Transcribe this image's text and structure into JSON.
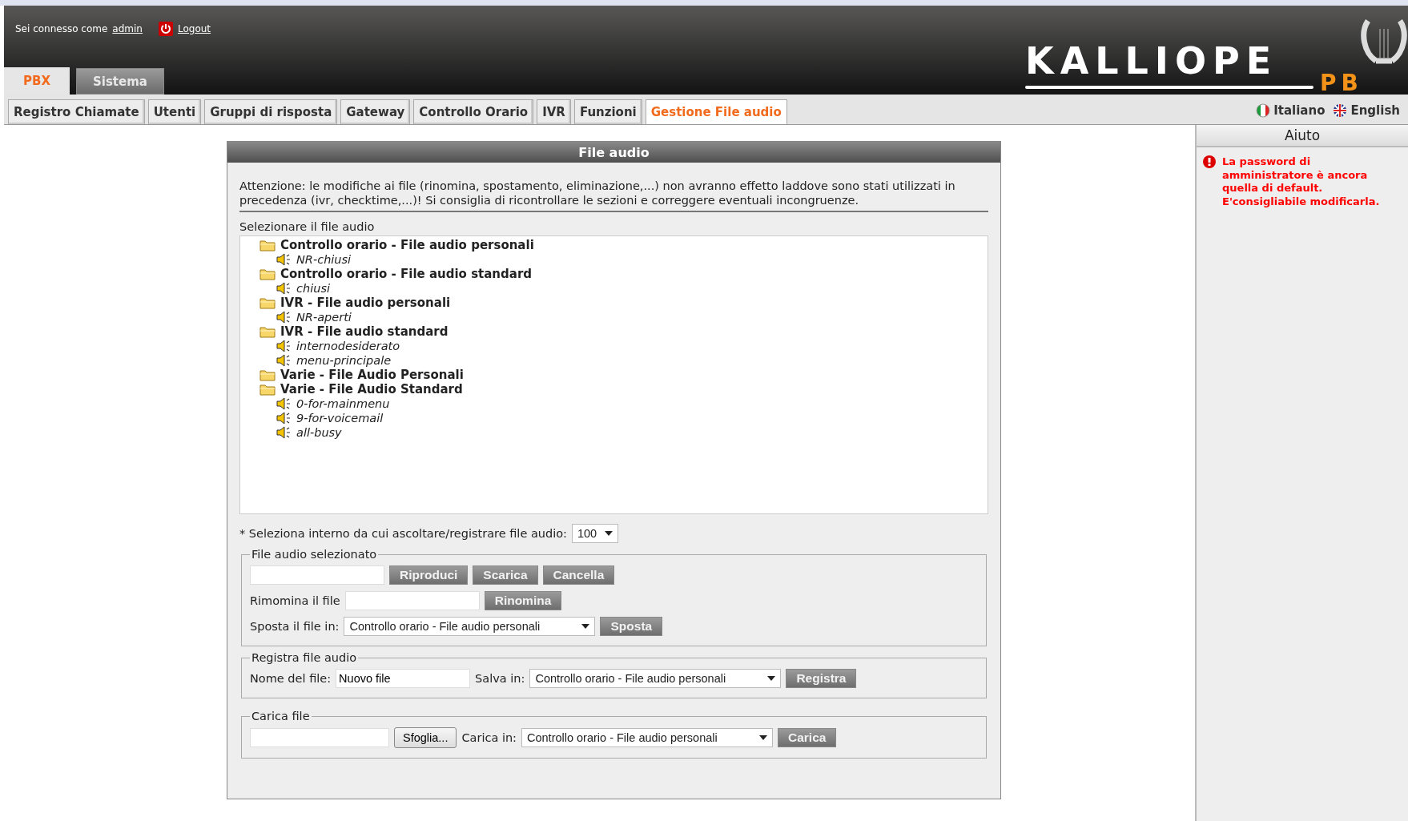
{
  "header": {
    "login_prefix": "Sei connesso come",
    "user": "admin",
    "logout": "Logout",
    "logo_title": "KALLIOPE",
    "logo_subtitle": "PB"
  },
  "main_tabs": [
    {
      "label": "PBX",
      "selected": true
    },
    {
      "label": "Sistema",
      "selected": false
    }
  ],
  "sub_tabs": [
    {
      "label": "Registro Chiamate",
      "selected": false
    },
    {
      "label": "Utenti",
      "selected": false
    },
    {
      "label": "Gruppi di risposta",
      "selected": false
    },
    {
      "label": "Gateway",
      "selected": false
    },
    {
      "label": "Controllo Orario",
      "selected": false
    },
    {
      "label": "IVR",
      "selected": false
    },
    {
      "label": "Funzioni",
      "selected": false
    },
    {
      "label": "Gestione File audio",
      "selected": true
    }
  ],
  "languages": [
    {
      "label": "Italiano",
      "kind": "it"
    },
    {
      "label": "English",
      "kind": "en"
    }
  ],
  "panel": {
    "title": "File audio",
    "warning": "Attenzione: le modifiche ai file (rinomina, spostamento, eliminazione,...) non avranno effetto laddove sono stati utilizzati in precedenza (ivr, checktime,...)! Si consiglia di ricontrollare le sezioni e correggere eventuali incongruenze.",
    "tree_label": "Selezionare il file audio",
    "tree": [
      {
        "label": "Controllo orario - File audio personali",
        "children": [
          {
            "label": "NR-chiusi"
          }
        ]
      },
      {
        "label": "Controllo orario - File audio standard",
        "children": [
          {
            "label": "chiusi"
          }
        ]
      },
      {
        "label": "IVR - File audio personali",
        "children": [
          {
            "label": "NR-aperti"
          }
        ]
      },
      {
        "label": "IVR - File audio standard",
        "children": [
          {
            "label": "internodesiderato"
          },
          {
            "label": "menu-principale"
          }
        ]
      },
      {
        "label": "Varie - File Audio Personali"
      },
      {
        "label": "Varie - File Audio Standard",
        "children": [
          {
            "label": "0-for-mainmenu"
          },
          {
            "label": "9-for-voicemail"
          },
          {
            "label": "all-busy"
          }
        ]
      }
    ],
    "extension_label": "* Seleziona interno da cui ascoltare/registrare file audio:",
    "extension_value": "100",
    "selected_file": {
      "legend": "File audio selezionato",
      "buttons": [
        "Riproduci",
        "Scarica",
        "Cancella"
      ],
      "rename_label": "Rimomina il file",
      "rename_button": "Rinomina",
      "move_label": "Sposta il file in:",
      "move_value": "Controllo orario - File audio personali",
      "move_button": "Sposta"
    },
    "record": {
      "legend": "Registra file audio",
      "name_label": "Nome del file:",
      "name_value": "Nuovo file",
      "save_label": "Salva in:",
      "save_value": "Controllo orario - File audio personali",
      "button": "Registra"
    },
    "upload": {
      "legend": "Carica file",
      "browse": "Sfoglia...",
      "target_label": "Carica in:",
      "target_value": "Controllo orario - File audio personali",
      "button": "Carica"
    }
  },
  "help": {
    "title": "Aiuto",
    "message": "La password di amministratore è ancora quella di default. E'consigliabile modificarla."
  }
}
